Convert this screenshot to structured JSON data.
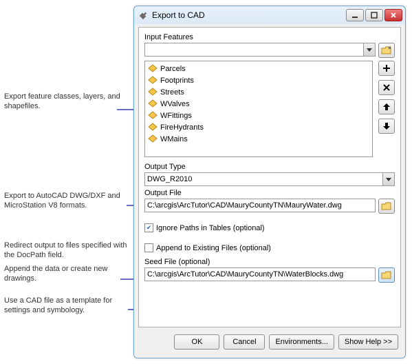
{
  "window": {
    "title": "Export to CAD"
  },
  "labels": {
    "input_features": "Input Features",
    "output_type": "Output Type",
    "output_file": "Output File",
    "seed_file": "Seed File (optional)"
  },
  "input_combo": {
    "value": ""
  },
  "features": [
    {
      "name": "Parcels"
    },
    {
      "name": "Footprints"
    },
    {
      "name": "Streets"
    },
    {
      "name": "WValves"
    },
    {
      "name": "WFittings"
    },
    {
      "name": "FireHydrants"
    },
    {
      "name": "WMains"
    }
  ],
  "output_type": {
    "value": "DWG_R2010"
  },
  "output_file": {
    "value": "C:\\arcgis\\ArcTutor\\CAD\\MauryCountyTN\\MauryWater.dwg"
  },
  "options": {
    "ignore_paths": {
      "label": "Ignore Paths in Tables (optional)",
      "checked": true
    },
    "append": {
      "label": "Append to Existing Files (optional)",
      "checked": false
    }
  },
  "seed_file": {
    "value": "C:\\arcgis\\ArcTutor\\CAD\\MauryCountyTN\\WaterBlocks.dwg"
  },
  "buttons": {
    "ok": "OK",
    "cancel": "Cancel",
    "environments": "Environments...",
    "help": "Show Help >>"
  },
  "annotations": {
    "a1": "Export feature classes, layers, and shapefiles.",
    "a2": "Export to AutoCAD DWG/DXF and MicroStation V8 formats.",
    "a3": "Redirect output to files specified with the DocPath field.",
    "a4": "Append the data or create new drawings.",
    "a5": "Use a CAD file as a template for settings and symbology."
  },
  "icons": {
    "browse": "browse-icon",
    "add": "plus-icon",
    "remove": "x-icon",
    "up": "arrow-up-icon",
    "down": "arrow-down-icon"
  }
}
